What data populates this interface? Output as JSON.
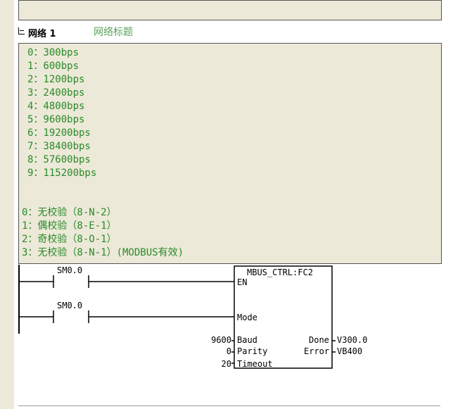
{
  "network": {
    "name": "网络 1",
    "title": "网络标题"
  },
  "comment": {
    "baud_rates": [
      "0：300bps",
      "1：600bps",
      "2：1200bps",
      "3：2400bps",
      "4：4800bps",
      "5：9600bps",
      "6：19200bps",
      "7：38400bps",
      "8：57600bps",
      "9：115200bps"
    ],
    "parity": [
      "0：无校验（8-N-2）",
      "1：偶校验（8-E-1）",
      "2：奇校验（8-O-1）",
      "3：无校验（8-N-1）(MODBUS有效)"
    ]
  },
  "ladder": {
    "contact1": "SM0.0",
    "contact2": "SM0.0",
    "block_title": "MBUS_CTRL:FC2",
    "en": "EN",
    "mode": "Mode",
    "baud": "Baud",
    "parity": "Parity",
    "timeout": "Timeout",
    "done": "Done",
    "error": "Error",
    "baud_value": "9600",
    "parity_value": "0",
    "timeout_value": "20",
    "done_output": "V300.0",
    "error_output": "VB400"
  }
}
